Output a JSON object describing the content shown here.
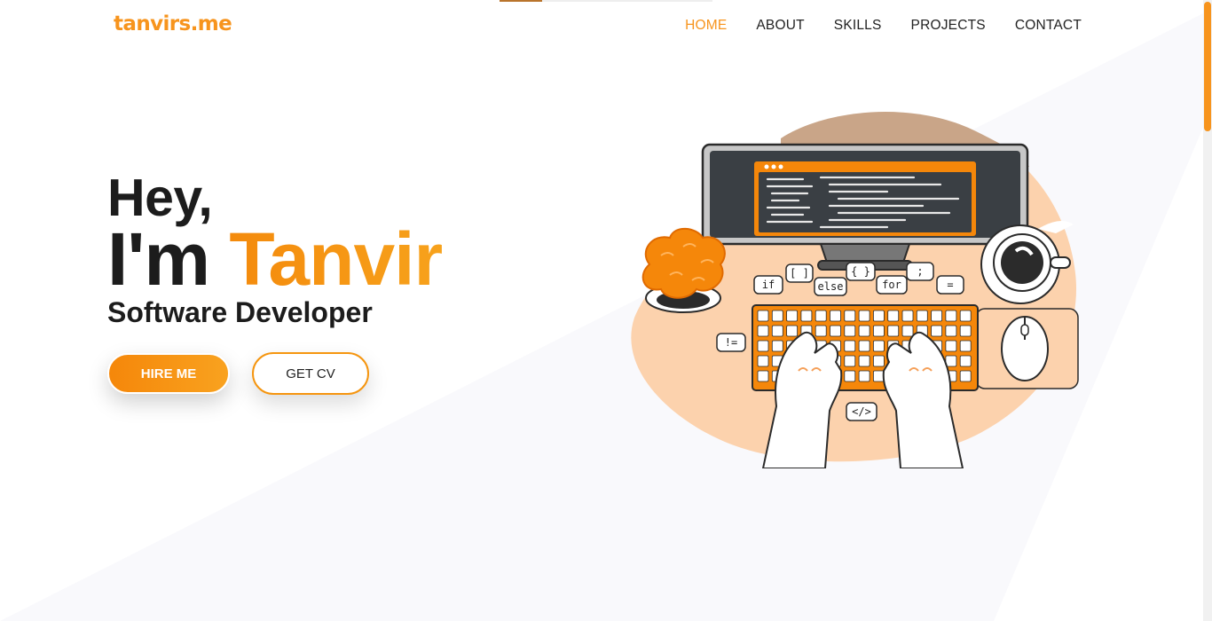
{
  "brand": {
    "logo_text": "tanvirs.me"
  },
  "nav": {
    "items": [
      {
        "label": "HOME",
        "active": true
      },
      {
        "label": "ABOUT",
        "active": false
      },
      {
        "label": "SKILLS",
        "active": false
      },
      {
        "label": "PROJECTS",
        "active": false
      },
      {
        "label": "CONTACT",
        "active": false
      }
    ]
  },
  "hero": {
    "greeting": "Hey,",
    "name_prefix": "I'm ",
    "name": "Tanvir",
    "role": "Software Developer",
    "buttons": {
      "hire": "HIRE ME",
      "cv": "GET CV"
    }
  },
  "illustration": {
    "icon": "developer-typing-illustration",
    "bubbles": [
      "if",
      "[ ]",
      "else",
      "{ }",
      "for",
      ";",
      "=",
      "!=",
      "</>"
    ]
  },
  "theme": {
    "accent": "#f7941d",
    "accent_light": "#f9a21f",
    "text": "#1c1c1c",
    "background_wedge": "#f9f9fc",
    "desk_blob": "#fcd2ad",
    "desk_blob_top": "#c9a588"
  },
  "reading_progress": 0.2
}
